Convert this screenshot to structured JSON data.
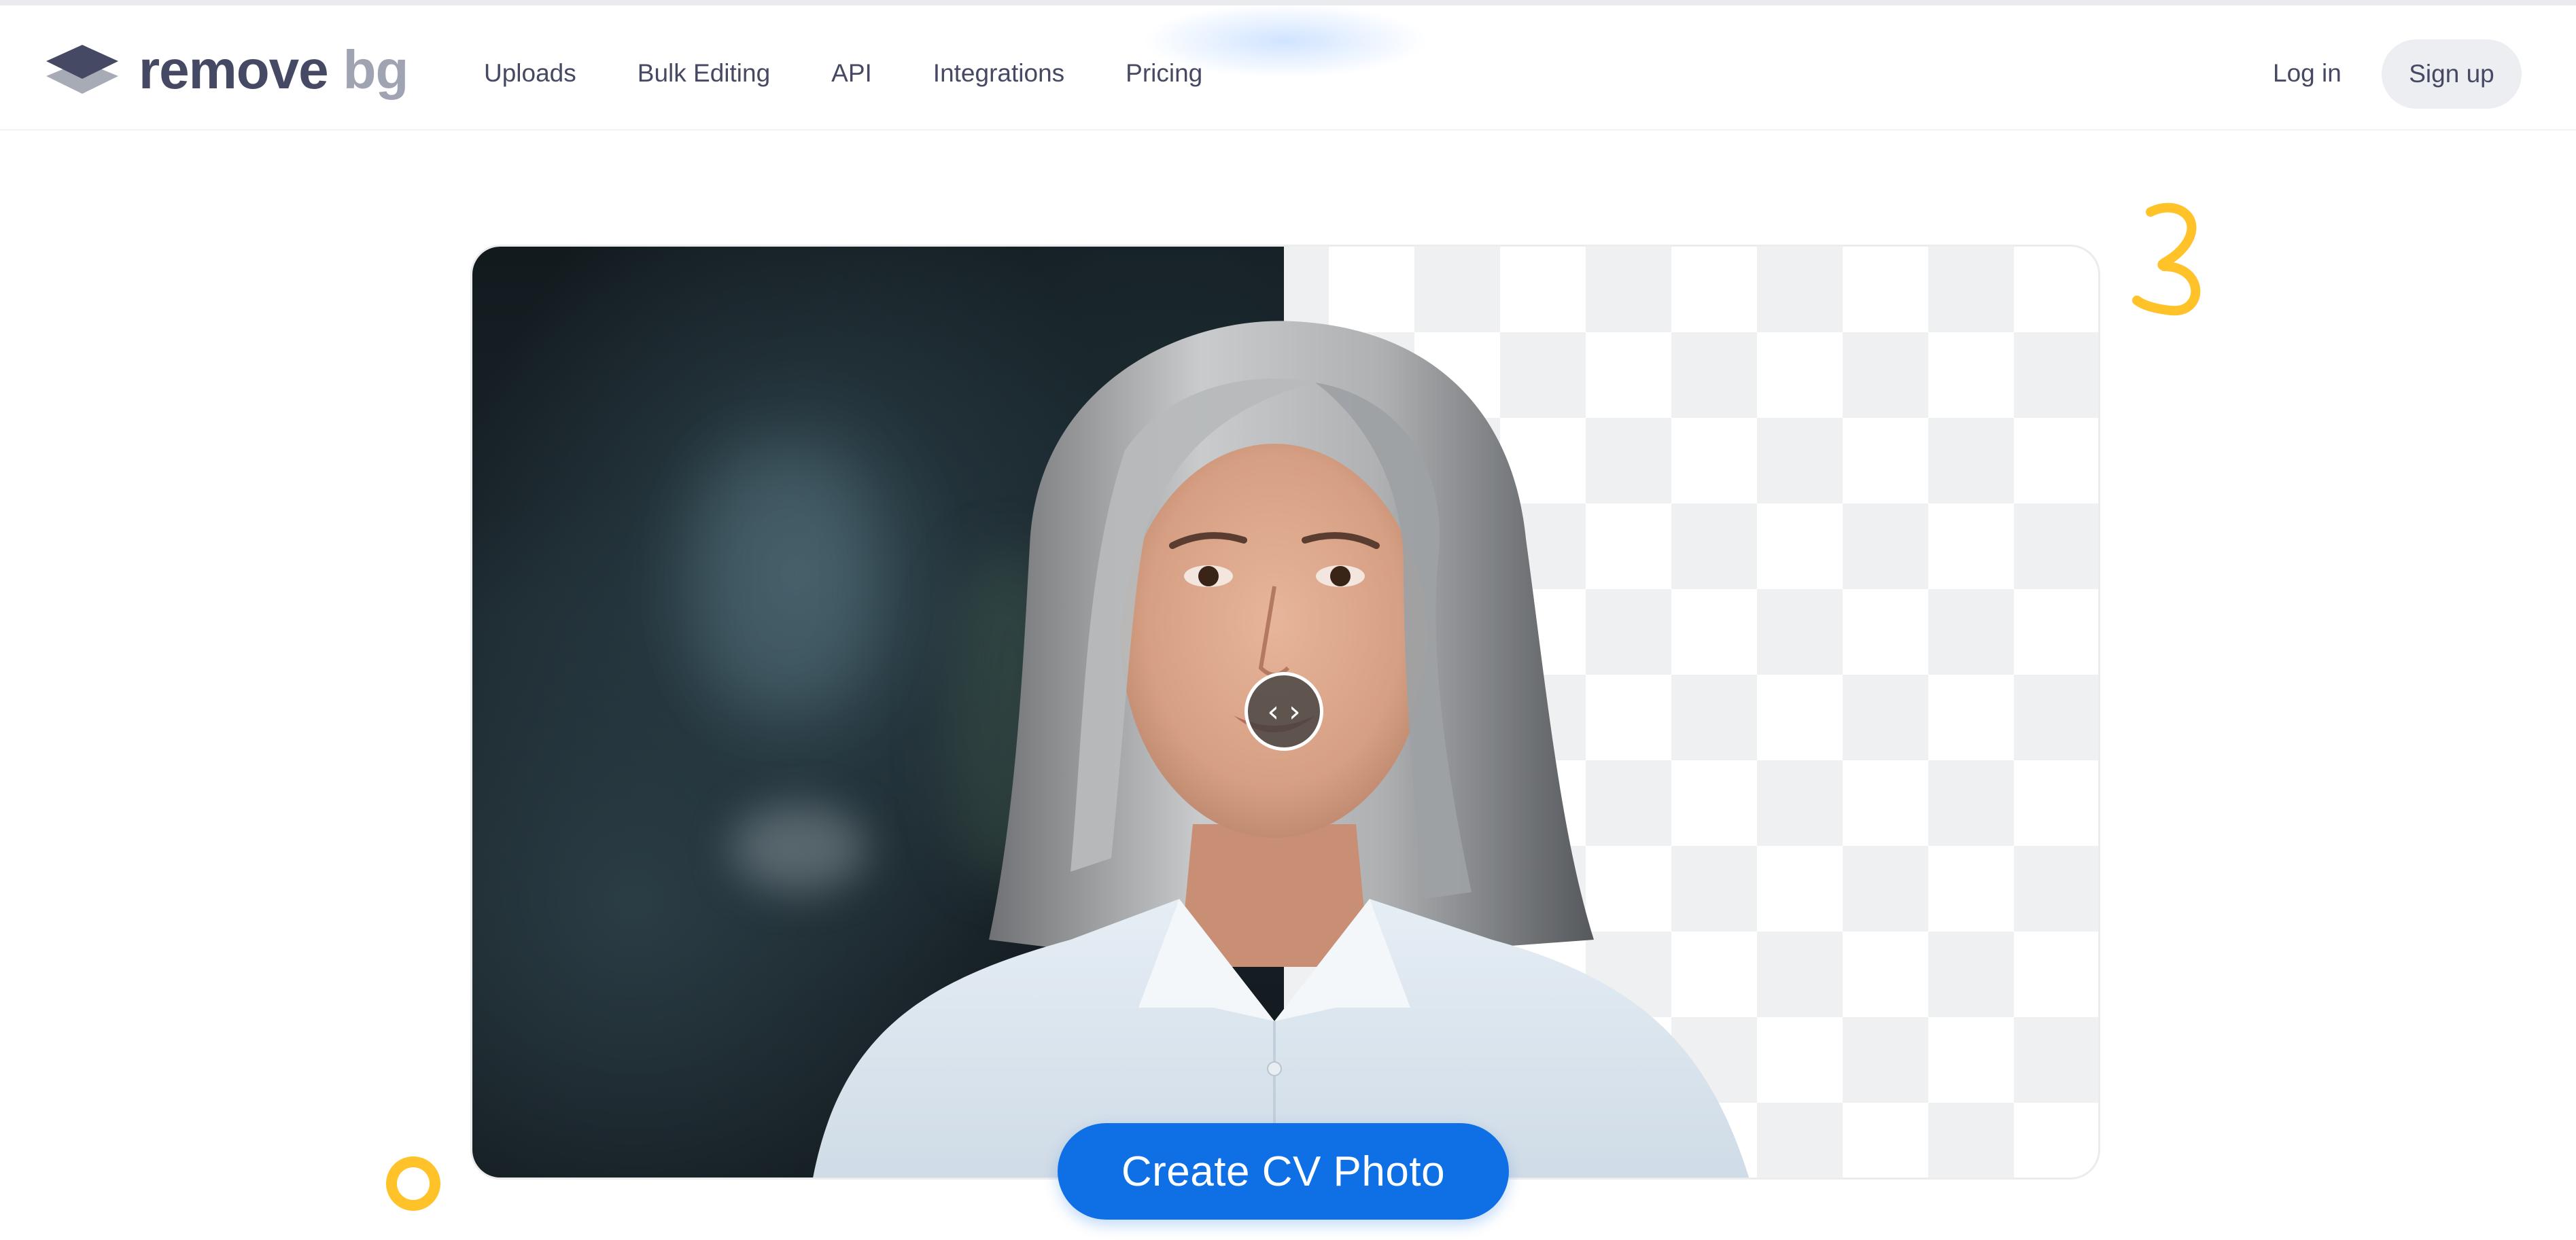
{
  "brand": {
    "logo_word_1": "remove",
    "logo_word_2": "bg",
    "logo_icon": "layers-icon"
  },
  "nav": {
    "items": [
      {
        "label": "Uploads"
      },
      {
        "label": "Bulk Editing"
      },
      {
        "label": "API"
      },
      {
        "label": "Integrations"
      },
      {
        "label": "Pricing"
      }
    ]
  },
  "auth": {
    "login_label": "Log in",
    "signup_label": "Sign up"
  },
  "hero": {
    "compare_handle_icon": "chevron-left-right-icon",
    "handle_left_glyph": "‹",
    "handle_right_glyph": "›",
    "cta_label": "Create CV Photo"
  },
  "colors": {
    "brand_text": "#454964",
    "brand_text_light": "#a0a3b1",
    "cta_blue": "#0f70e6",
    "accent_yellow": "#ffc229",
    "checker_gray": "#eff0f2"
  }
}
